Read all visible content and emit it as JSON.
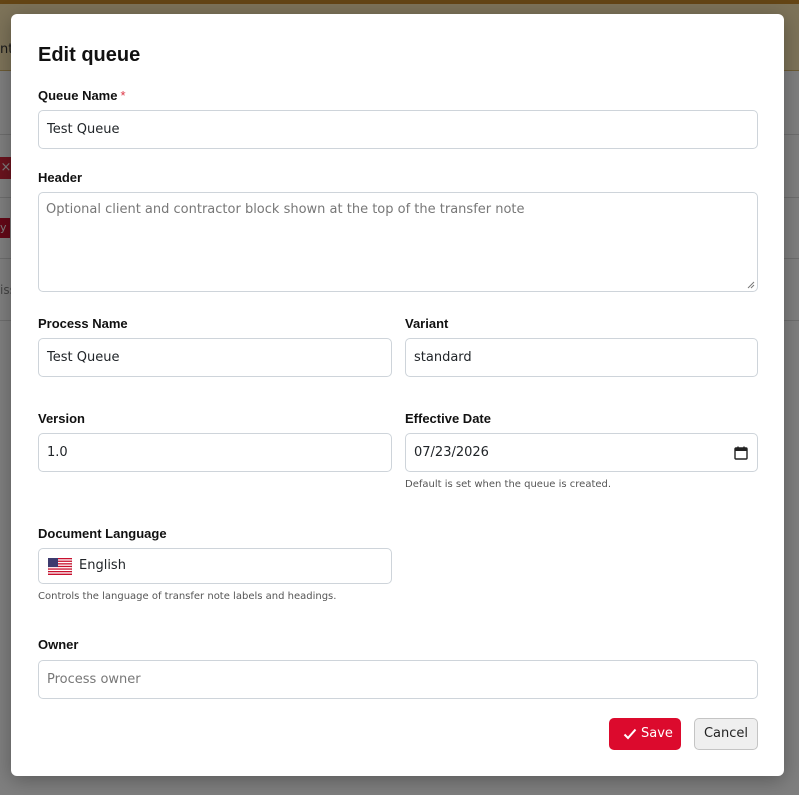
{
  "background": {
    "banner_text": "nt",
    "close_glyph": "×",
    "pill_text": "y",
    "side_text": "iss"
  },
  "modal": {
    "title": "Edit queue",
    "fields": {
      "queue_name": {
        "label": "Queue Name",
        "required_mark": "*",
        "value": "Test Queue"
      },
      "header": {
        "label": "Header",
        "placeholder": "Optional client and contractor block shown at the top of the transfer note"
      },
      "process_name": {
        "label": "Process Name",
        "value": "Test Queue"
      },
      "variant": {
        "label": "Variant",
        "value": "standard"
      },
      "version": {
        "label": "Version",
        "value": "1.0"
      },
      "effective_date": {
        "label": "Effective Date",
        "value": "07/23/2026",
        "help": "Default is set when the queue is created."
      },
      "document_language": {
        "label": "Document Language",
        "value": "English",
        "flag_icon": "us-flag-icon",
        "help": "Controls the language of transfer note labels and headings."
      },
      "owner": {
        "label": "Owner",
        "placeholder": "Process owner"
      }
    },
    "buttons": {
      "save": "Save",
      "cancel": "Cancel"
    }
  },
  "colors": {
    "accent": "#dc0a2d",
    "required": "#dc3545",
    "banner": "#fbe6b3"
  }
}
